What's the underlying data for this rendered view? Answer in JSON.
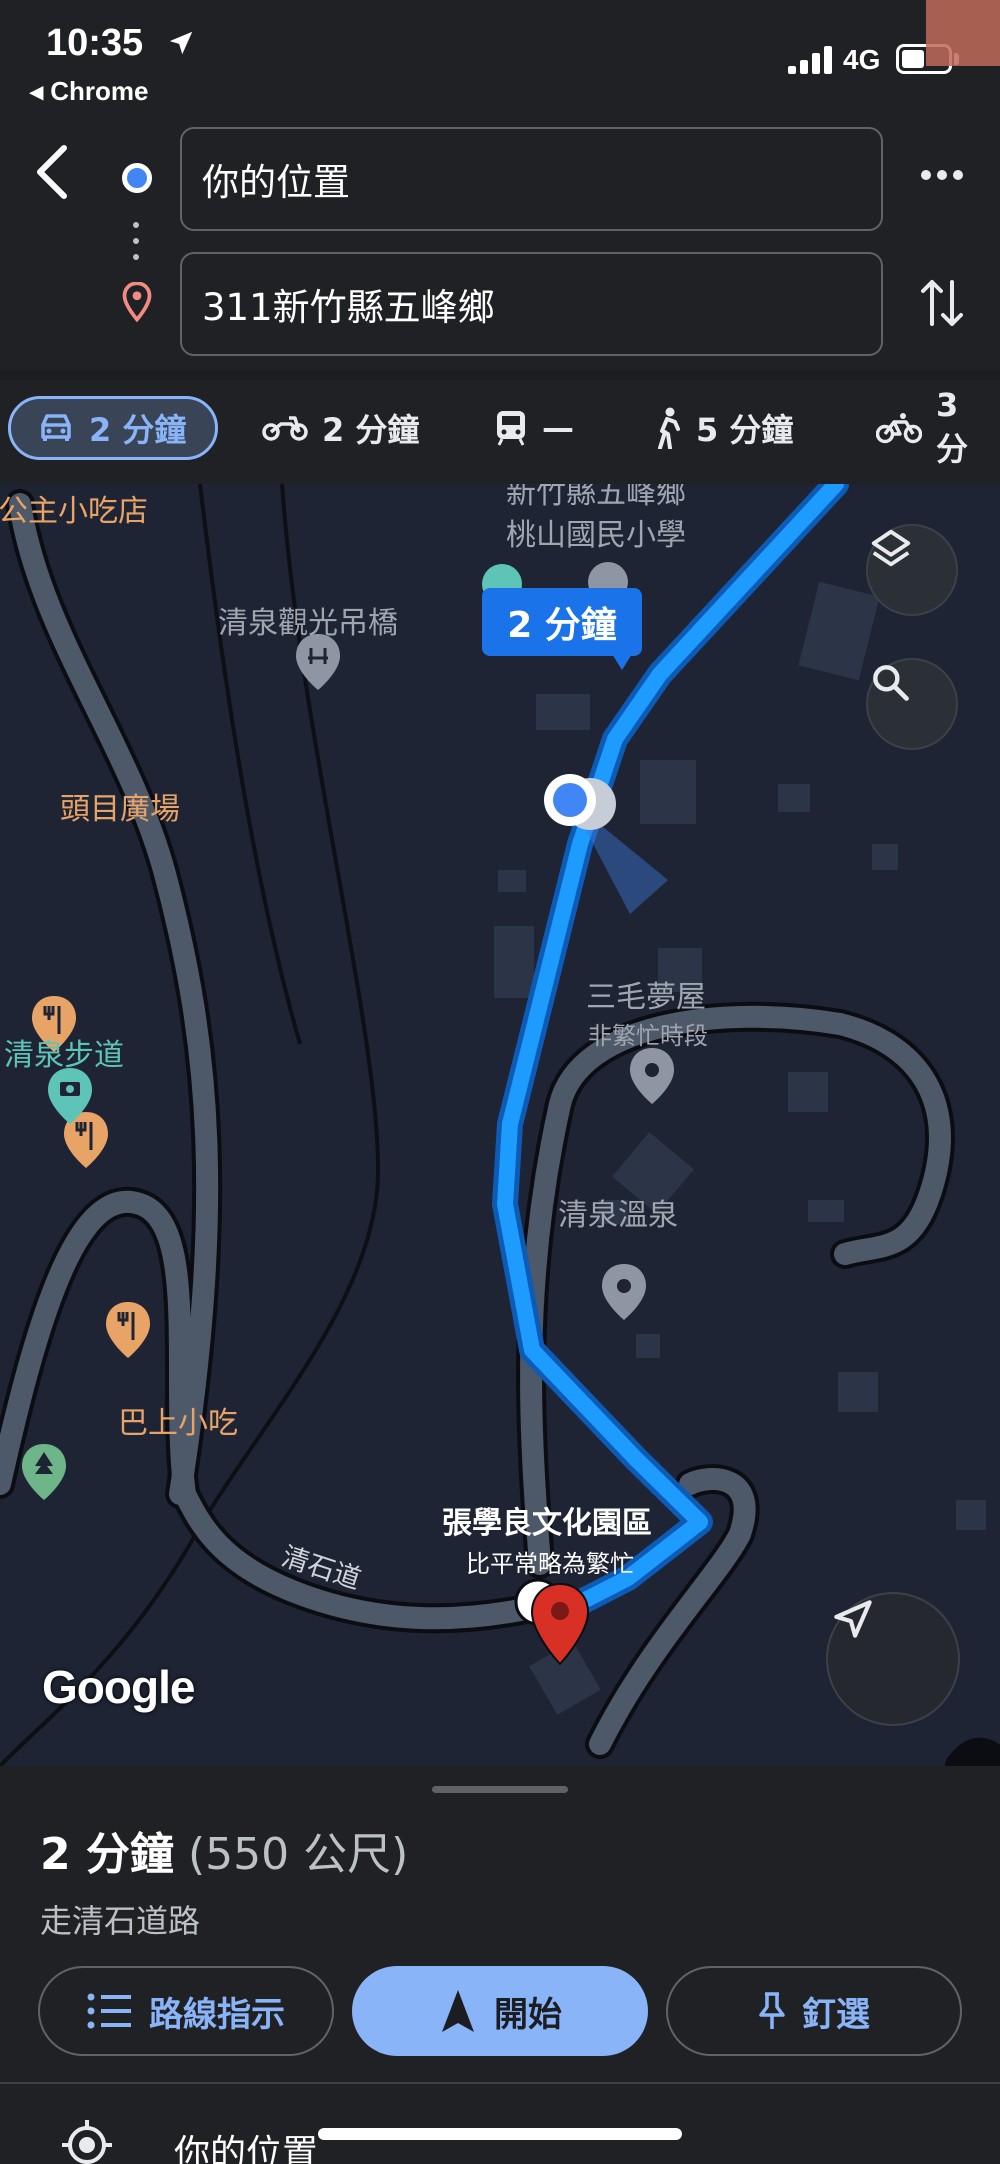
{
  "status_bar": {
    "time": "10:35",
    "back_app": "◂ Chrome",
    "network": "4G"
  },
  "directions": {
    "origin": "你的位置",
    "destination": "311新竹縣五峰鄉"
  },
  "modes": [
    {
      "name": "car",
      "label": "2 分鐘",
      "active": true
    },
    {
      "name": "motorcycle",
      "label": "2 分鐘"
    },
    {
      "name": "transit",
      "label": "—"
    },
    {
      "name": "walk",
      "label": "5 分鐘"
    },
    {
      "name": "bike",
      "label": "3 分"
    }
  ],
  "map": {
    "eta_callout": "2 分鐘",
    "labels": {
      "restaurant_top": "公主小吃店",
      "school_top": "新竹縣五峰鄉",
      "school": "桃山國民小學",
      "bridge": "清泉觀光吊橋",
      "plaza": "頭目廣場",
      "sanmao": "三毛夢屋",
      "sanmao_status": "非繁忙時段",
      "trail": "清泉步道",
      "hotspring": "清泉溫泉",
      "bashang": "巴上小吃",
      "zhang": "張學良文化園區",
      "zhang_status": "比平常略為繁忙",
      "road": "清石道"
    },
    "logo": "Google"
  },
  "sheet": {
    "duration": "2 分鐘",
    "distance": "(550 公尺)",
    "via": "走清石道路",
    "steps_label": "路線指示",
    "start_label": "開始",
    "pin_label": "釘選",
    "list_label": "你的位置"
  },
  "colors": {
    "route": "#1e9bff",
    "accent": "#8ab4f8",
    "map_bg": "#1e2433"
  }
}
